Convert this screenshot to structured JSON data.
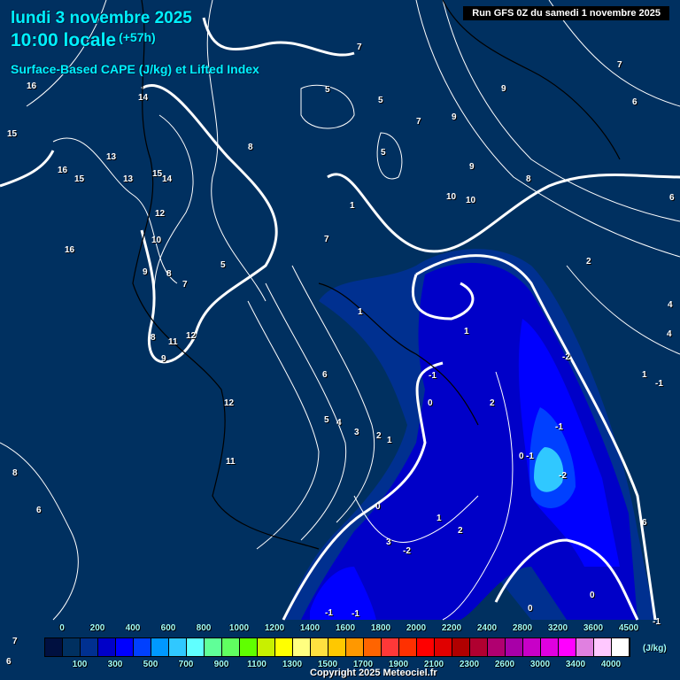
{
  "header": {
    "date": "lundi 3 novembre 2025",
    "hour": "10:00 locale",
    "lead": "(+57h)",
    "title": "Surface-Based CAPE (J/kg) et Lifted Index",
    "run": "Run GFS 0Z du samedi 1 novembre 2025"
  },
  "legend": {
    "unit": "(J/kg)",
    "colors": [
      "#001040",
      "#003060",
      "#003090",
      "#0000c8",
      "#0000ff",
      "#0040ff",
      "#0098ff",
      "#30c8ff",
      "#60ffff",
      "#60ff98",
      "#60ff60",
      "#60ff00",
      "#c8f000",
      "#ffff00",
      "#ffff80",
      "#ffe040",
      "#ffc800",
      "#ff9800",
      "#ff6400",
      "#ff3838",
      "#ff3000",
      "#ff0000",
      "#e00000",
      "#b00000",
      "#b00030",
      "#b00070",
      "#a800a8",
      "#c800c8",
      "#e000e0",
      "#ff00ff",
      "#e080e0",
      "#ffc8ff",
      "#ffffff"
    ],
    "labels": [
      "0",
      "100",
      "200",
      "300",
      "400",
      "500",
      "600",
      "700",
      "800",
      "900",
      "1000",
      "1100",
      "1200",
      "1300",
      "1400",
      "1500",
      "1600",
      "1700",
      "1800",
      "1900",
      "2000",
      "2100",
      "2200",
      "2300",
      "2400",
      "2600",
      "2800",
      "3000",
      "3200",
      "3400",
      "3600",
      "4000",
      "4500"
    ]
  },
  "lifted_index_labels": [
    "16",
    "15",
    "14",
    "13",
    "15",
    "14",
    "16",
    "15",
    "13",
    "12",
    "16",
    "10",
    "9",
    "8",
    "7",
    "5",
    "9",
    "11",
    "12",
    "9",
    "8",
    "12",
    "11",
    "8",
    "6",
    "7",
    "7",
    "5",
    "5",
    "6",
    "7",
    "8",
    "9",
    "9",
    "8",
    "10",
    "10",
    "6",
    "7",
    "1",
    "2",
    "5",
    "4",
    "1",
    "4",
    "6",
    "5",
    "4",
    "3",
    "2",
    "1",
    "1",
    "-1",
    "0",
    "2",
    "-2",
    "-1",
    "0",
    "-1",
    "-2",
    "1",
    "0",
    "2",
    "3",
    "-2",
    "-1",
    "-1",
    "0",
    "0",
    "-1",
    "1",
    "-1",
    "7",
    "6",
    "6"
  ],
  "footer": {
    "copyright": "Copyright 2025 Meteociel.fr"
  }
}
